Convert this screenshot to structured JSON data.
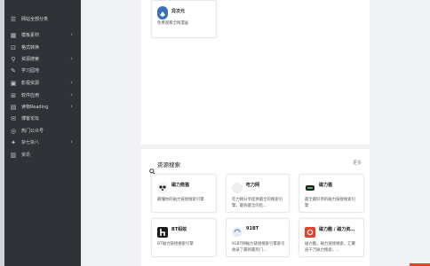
{
  "sidebar": {
    "items": [
      {
        "label": "网站全部分类",
        "icon": "list-icon",
        "chevron": false
      },
      {
        "label": "模板素材",
        "icon": "grid-icon",
        "chevron": true
      },
      {
        "label": "格式转换",
        "icon": "convert-icon",
        "chevron": false
      },
      {
        "label": "资源搜索",
        "icon": "search-icon",
        "chevron": true
      },
      {
        "label": "学习园地",
        "icon": "book-icon",
        "chevron": false
      },
      {
        "label": "影视资源",
        "icon": "film-icon",
        "chevron": true
      },
      {
        "label": "软件应用",
        "icon": "app-icon",
        "chevron": true
      },
      {
        "label": "读物Reading",
        "icon": "reading-icon",
        "chevron": true
      },
      {
        "label": "博客论坛",
        "icon": "blog-icon",
        "chevron": false
      },
      {
        "label": "热门公众号",
        "icon": "wechat-icon",
        "chevron": false
      },
      {
        "label": "杂七杂八",
        "icon": "misc-icon",
        "chevron": true
      },
      {
        "label": "资讯",
        "icon": "news-icon",
        "chevron": false
      }
    ],
    "chevron_glyph": "›"
  },
  "top_card": {
    "name": "异次元",
    "desc": "免费观看全网漫画"
  },
  "section": {
    "title": "资源搜索",
    "more": "更多",
    "cards": [
      {
        "name": "磁力熊猫",
        "desc": "最懂你的磁力链接搜索引擎",
        "logo_color": "#f2f2f2"
      },
      {
        "name": "吃力网",
        "desc": "吃力网分享提供最全的搜索引擎，最快最全的吃…",
        "logo_color": "#eeeeee"
      },
      {
        "name": "磁力猫",
        "desc": "最全最好用的磁力链接搜索引擎",
        "logo_color": "#e9ece9"
      },
      {
        "name": "BT蚂蚁",
        "desc": "BT磁力链接搜索引擎",
        "logo_color": "#1a1a1a"
      },
      {
        "name": "91BT",
        "desc": "91BT网磁力链接搜索引擎索引收录了最新最热门…",
        "logo_color": "#e9edf5"
      },
      {
        "name": "磁力酷 / 磁力资…",
        "desc": "磁力酷，磁力链接搜索，汇聚迪千万磁力搜索，…",
        "logo_color": "#e8402b"
      }
    ]
  }
}
